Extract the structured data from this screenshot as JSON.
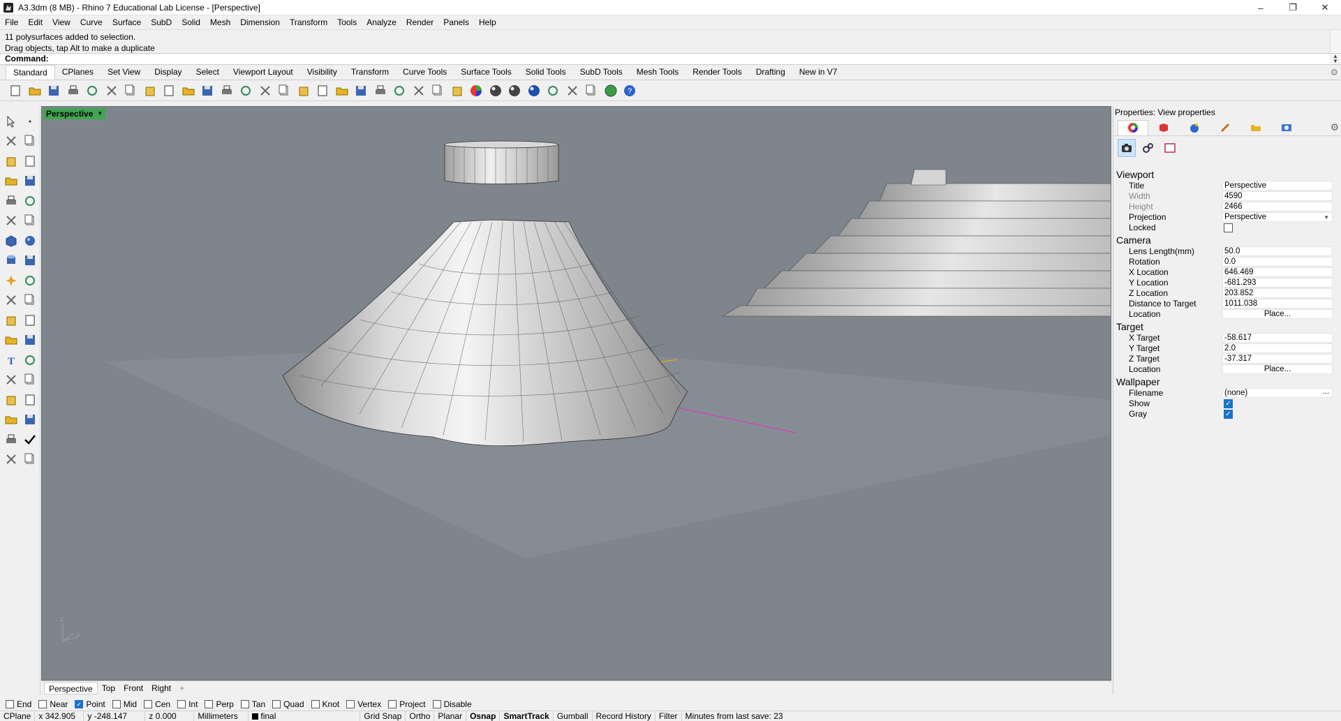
{
  "window": {
    "title": "A3.3dm (8 MB) - Rhino 7 Educational Lab License - [Perspective]",
    "controls": [
      "minimize-icon",
      "restore-icon",
      "close-icon"
    ]
  },
  "menu": [
    "File",
    "Edit",
    "View",
    "Curve",
    "Surface",
    "SubD",
    "Solid",
    "Mesh",
    "Dimension",
    "Transform",
    "Tools",
    "Analyze",
    "Render",
    "Panels",
    "Help"
  ],
  "command": {
    "history": [
      "11 polysurfaces added to selection.",
      "Drag objects, tap Alt to make a duplicate"
    ],
    "prompt": "Command:"
  },
  "toolbar_tabs": [
    "Standard",
    "CPlanes",
    "Set View",
    "Display",
    "Select",
    "Viewport Layout",
    "Visibility",
    "Transform",
    "Curve Tools",
    "Surface Tools",
    "Solid Tools",
    "SubD Tools",
    "Mesh Tools",
    "Render Tools",
    "Drafting",
    "New in V7"
  ],
  "toolbar_icons": [
    "new-file-icon",
    "open-file-icon",
    "save-icon",
    "print-icon",
    "import-icon",
    "cut-icon",
    "copy-icon",
    "paste-icon",
    "undo-icon",
    "pan-icon",
    "move-view-icon",
    "zoom-icon",
    "zoom-window-icon",
    "zoom-extents-icon",
    "zoom-selected-icon",
    "rotate-view-icon",
    "four-views-icon",
    "car-icon",
    "lightbulb-plane-icon",
    "grid-snap-icon",
    "points-icon",
    "light-icon",
    "lock-icon",
    "layers-icon",
    "color-wheel-icon",
    "shaded-sphere-icon",
    "rendered-sphere-icon",
    "blue-sphere-icon",
    "render-icon",
    "settings-gear-icon",
    "options-icon",
    "globe-icon",
    "help-icon"
  ],
  "viewport": {
    "name": "Perspective",
    "tabs": [
      "Perspective",
      "Top",
      "Front",
      "Right"
    ],
    "axis_labels": {
      "z": "z",
      "y": "y",
      "x": "x"
    }
  },
  "properties": {
    "title": "Properties: View properties",
    "sections": {
      "viewport": "Viewport",
      "camera": "Camera",
      "target": "Target",
      "wallpaper": "Wallpaper"
    },
    "viewport": {
      "title_label": "Title",
      "title_value": "Perspective",
      "width_label": "Width",
      "width_value": "4590",
      "height_label": "Height",
      "height_value": "2466",
      "projection_label": "Projection",
      "projection_value": "Perspective",
      "locked_label": "Locked",
      "locked": false
    },
    "camera": {
      "lens_label": "Lens Length(mm)",
      "lens_value": "50.0",
      "rotation_label": "Rotation",
      "rotation_value": "0.0",
      "xloc_label": "X Location",
      "xloc_value": "646.469",
      "yloc_label": "Y Location",
      "yloc_value": "-681.293",
      "zloc_label": "Z Location",
      "zloc_value": "203.852",
      "dist_label": "Distance to Target",
      "dist_value": "1011.038",
      "location_label": "Location",
      "location_button": "Place..."
    },
    "target": {
      "x_label": "X Target",
      "x_value": "-58.617",
      "y_label": "Y Target",
      "y_value": "2.0",
      "z_label": "Z Target",
      "z_value": "-37.317",
      "location_label": "Location",
      "location_button": "Place..."
    },
    "wallpaper": {
      "filename_label": "Filename",
      "filename_value": "(none)",
      "filename_more": "...",
      "show_label": "Show",
      "show": true,
      "gray_label": "Gray",
      "gray": true
    }
  },
  "osnaps": [
    {
      "label": "End",
      "on": false
    },
    {
      "label": "Near",
      "on": false
    },
    {
      "label": "Point",
      "on": true
    },
    {
      "label": "Mid",
      "on": false
    },
    {
      "label": "Cen",
      "on": false
    },
    {
      "label": "Int",
      "on": false
    },
    {
      "label": "Perp",
      "on": false
    },
    {
      "label": "Tan",
      "on": false
    },
    {
      "label": "Quad",
      "on": false
    },
    {
      "label": "Knot",
      "on": false
    },
    {
      "label": "Vertex",
      "on": false
    },
    {
      "label": "Project",
      "on": false
    },
    {
      "label": "Disable",
      "on": false
    }
  ],
  "status": {
    "cplane": "CPlane",
    "x": "x 342.905",
    "y": "y -248.147",
    "z": "z 0.000",
    "units": "Millimeters",
    "layer": "final",
    "grid_snap": "Grid Snap",
    "ortho": "Ortho",
    "planar": "Planar",
    "osnap": "Osnap",
    "smarttrack": "SmartTrack",
    "gumball": "Gumball",
    "record_history": "Record History",
    "filter": "Filter",
    "save_info": "Minutes from last save: 23"
  },
  "colors": {
    "viewport_bg": "#7f858d",
    "viewport_title_bg": "#41a551",
    "checkbox_on": "#1a73c9",
    "x_axis": "#e8a020",
    "y_axis": "#d040c0"
  }
}
